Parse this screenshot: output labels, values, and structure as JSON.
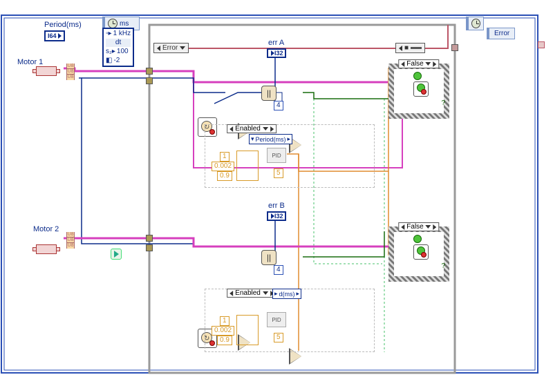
{
  "timing": {
    "unit": "ms",
    "rate": "1 kHz",
    "dt_label": "dt",
    "dt_value": "100",
    "neg2": "-2"
  },
  "period_label": "Period(ms)",
  "i64_tag": "I64",
  "motors": {
    "a": {
      "label": "Motor 1",
      "err_label": "err A",
      "err_type": "I32"
    },
    "b": {
      "label": "Motor 2",
      "err_label": "err B",
      "err_type": "I32"
    }
  },
  "pid": {
    "enabled_sel": "Enabled",
    "period_prop": "Period(ms)",
    "period_prop_b": "d(ms)",
    "kp": "1",
    "ki": "0.002",
    "kd": "0.9",
    "out_const": "5",
    "four_const": "4",
    "pid_label": "PID"
  },
  "case": {
    "false_label": "False"
  },
  "error": {
    "left_label": "Error",
    "right_label": "Error",
    "sel_marker": "■"
  }
}
